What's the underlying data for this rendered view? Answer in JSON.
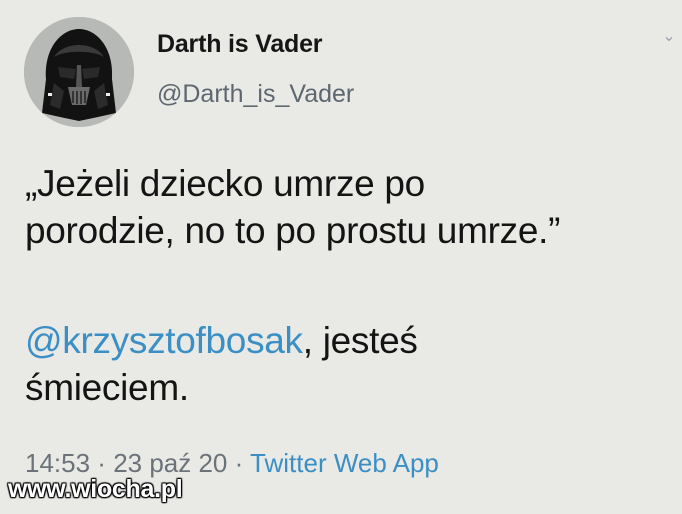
{
  "author": {
    "display_name": "Darth is Vader",
    "handle": "@Darth_is_Vader",
    "avatar_icon": "darth-vader-helmet-icon"
  },
  "tweet": {
    "line1": "„Jeżeli dziecko umrze po",
    "line2": "porodzie, no to po prostu umrze.”",
    "mention": "@krzysztofbosak",
    "after_mention": ", jesteś",
    "line4": "śmieciem."
  },
  "meta": {
    "time": "14:53",
    "sep1": " · ",
    "date": "23 paź 20",
    "sep2": " · ",
    "source": "Twitter Web App"
  },
  "watermark": "www.wiocha.pl",
  "colors": {
    "background": "#e9e9e6",
    "link": "#3b8fc4",
    "muted": "#6b7379",
    "text": "#141414"
  }
}
